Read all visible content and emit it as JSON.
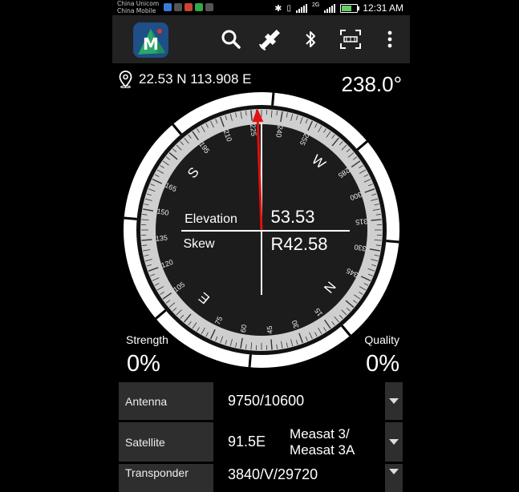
{
  "status_bar": {
    "carrier_1": "China Unicom",
    "carrier_2": "China Mobile",
    "network": "2G",
    "time": "12:31 AM"
  },
  "toolbar": {
    "logo_letter": "M",
    "icons": [
      "search-icon",
      "satellite-finder-icon",
      "bluetooth-icon",
      "ar-scan-icon",
      "more-vert-icon"
    ]
  },
  "location": {
    "coords": "22.53 N 113.908 E"
  },
  "azimuth": "238.0°",
  "compass": {
    "elevation_label": "Elevation",
    "elevation_value": "53.53",
    "skew_label": "Skew",
    "skew_value": "R42.58",
    "directions": [
      "S",
      "W",
      "N",
      "E"
    ],
    "needle_bearing": 228,
    "colors": {
      "needle": "#e01010",
      "ring": "#ffffff",
      "dial": "#1c1c1c"
    }
  },
  "strength": {
    "label": "Strength",
    "value": "0%"
  },
  "quality": {
    "label": "Quality",
    "value": "0%"
  },
  "fields": {
    "antenna": {
      "label": "Antenna",
      "value": "9750/10600"
    },
    "satellite": {
      "label": "Satellite",
      "position": "91.5E",
      "name": "Measat 3/ Measat 3A"
    },
    "transponder": {
      "label": "Transponder",
      "value": "3840/V/29720"
    }
  }
}
